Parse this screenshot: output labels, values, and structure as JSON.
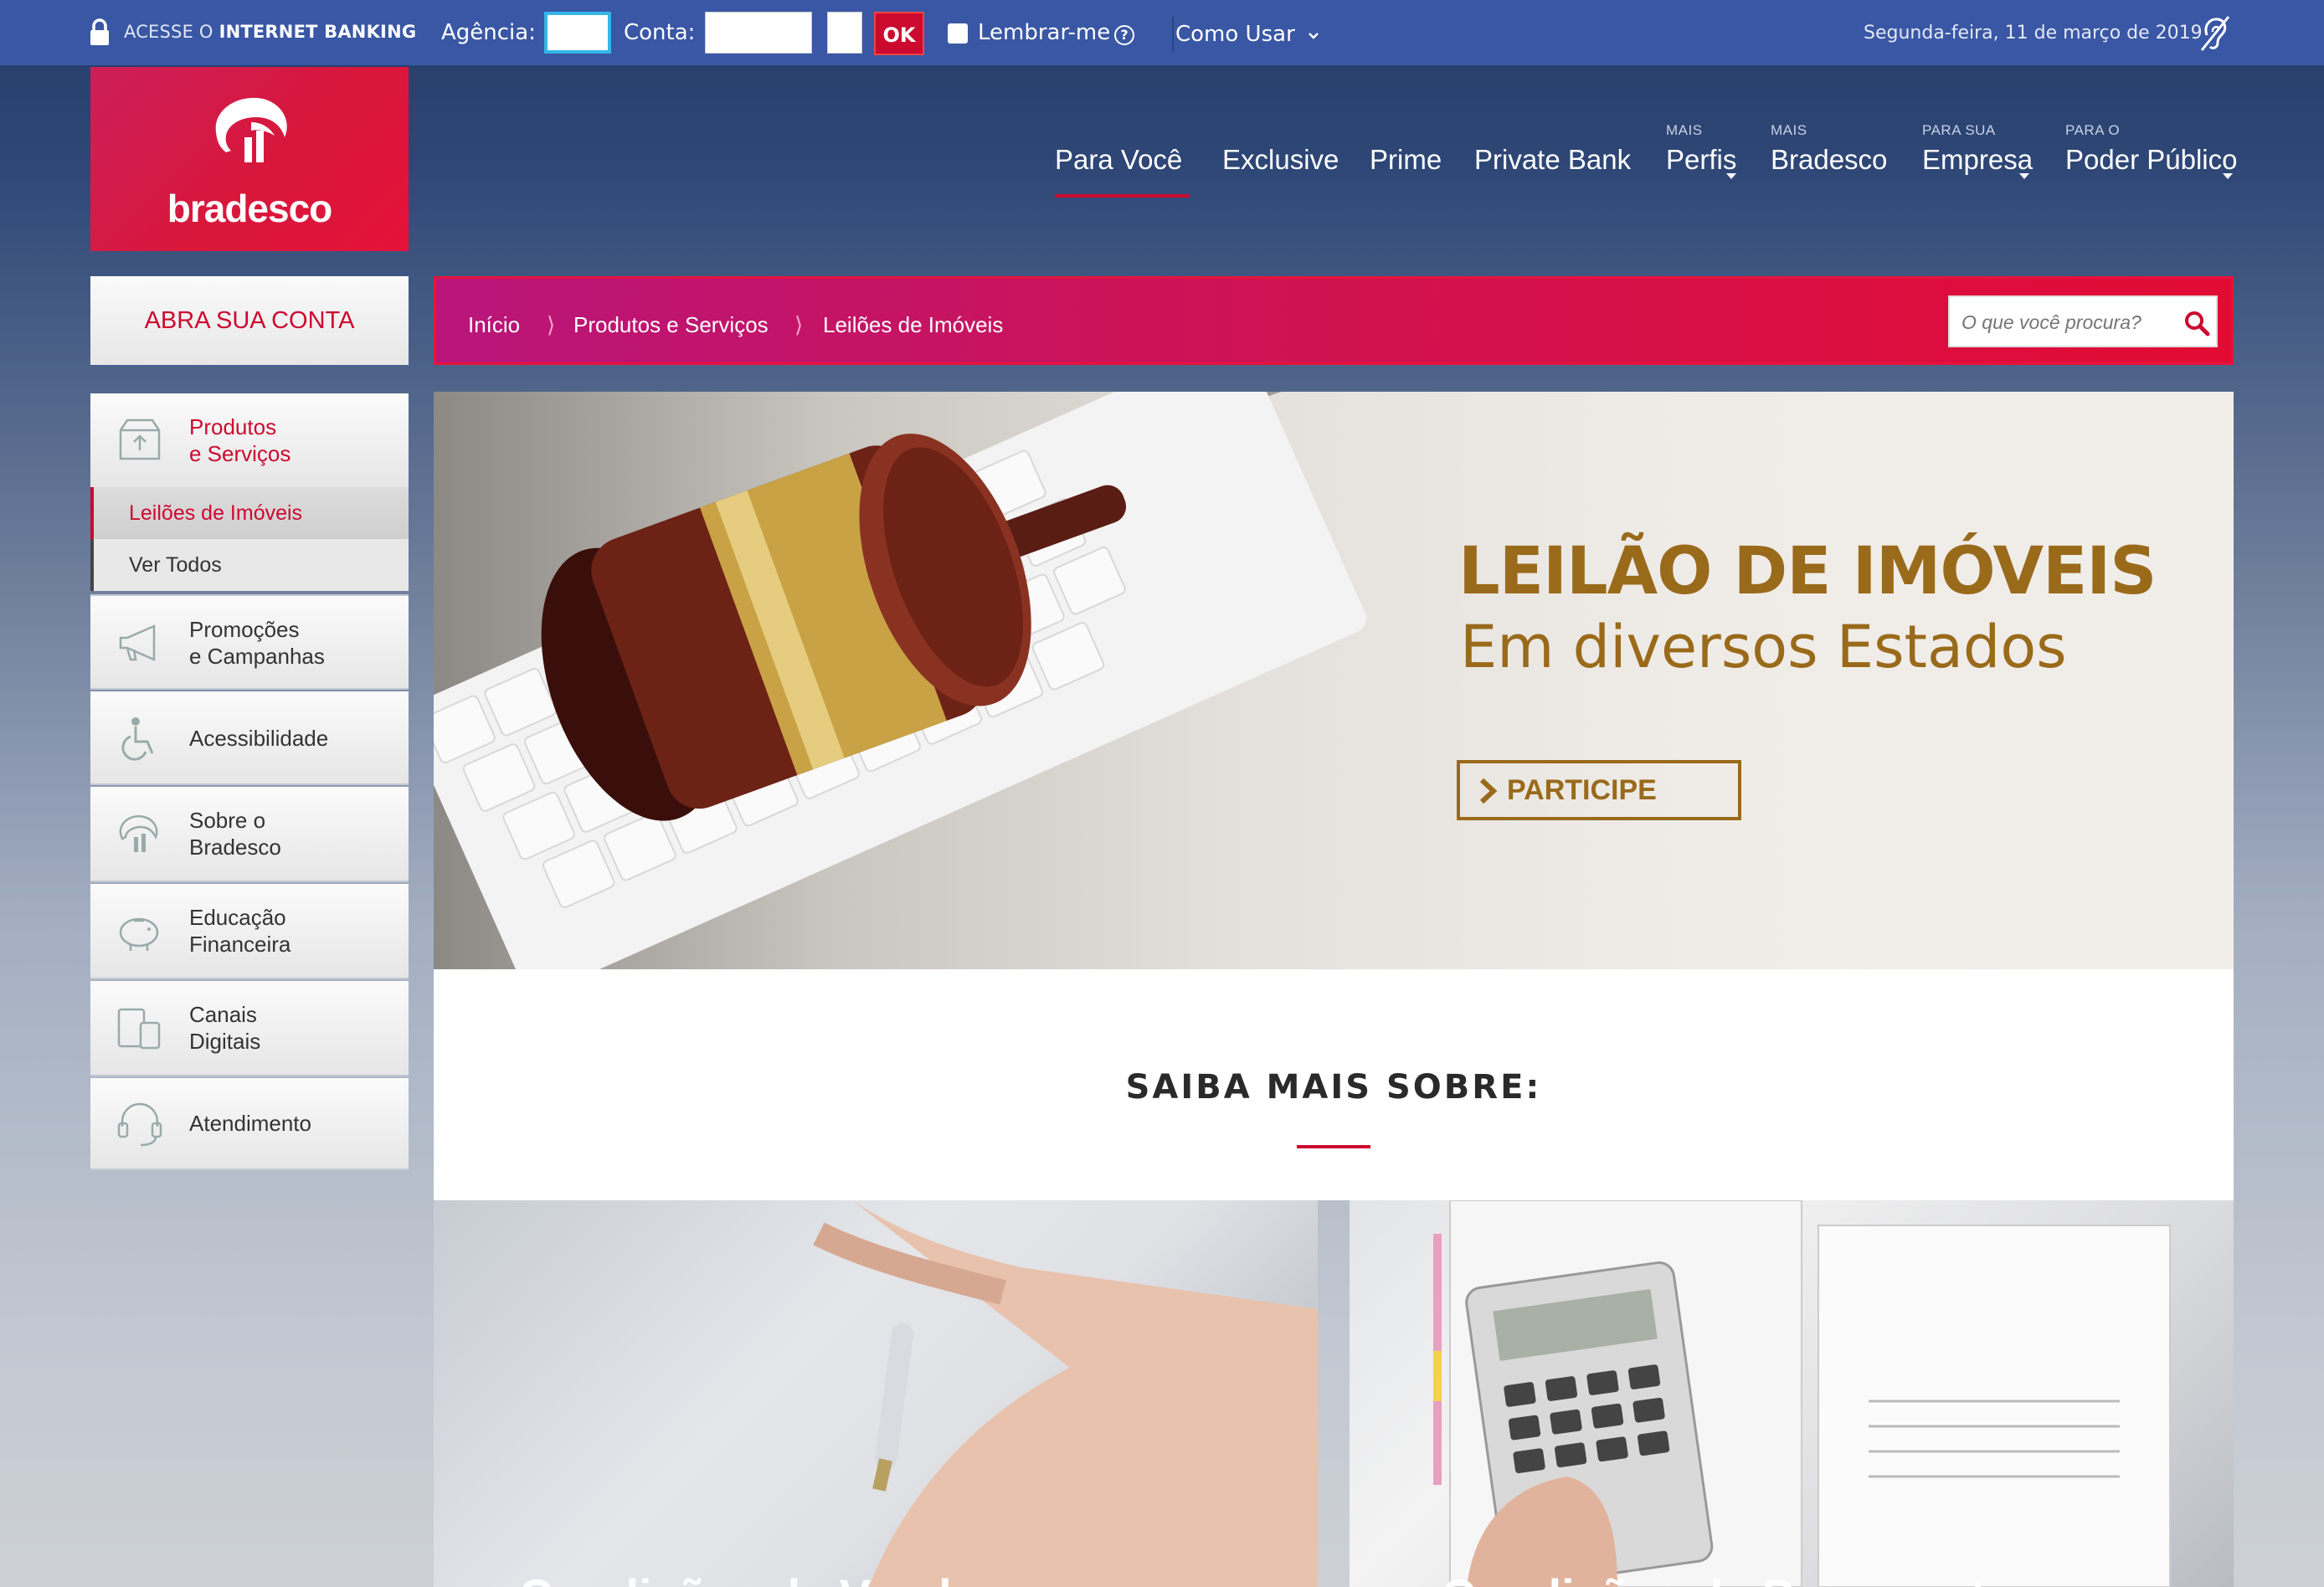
{
  "topbar": {
    "internet_banking_prefix": "ACESSE O",
    "internet_banking_bold": "INTERNET BANKING",
    "agencia_label": "Agência:",
    "conta_label": "Conta:",
    "ok_label": "OK",
    "remember_label": "Lembrar-me",
    "help_glyph": "?",
    "como_usar_label": "Como Usar",
    "date": "Segunda-feira, 11 de março de 2019",
    "icons": [
      "lock-icon",
      "help-icon",
      "chevron-down-icon",
      "hearing-icon"
    ]
  },
  "brand": {
    "name": "bradesco",
    "color": "#cc092f"
  },
  "nav": {
    "items": [
      {
        "small": "",
        "label": "Para Você",
        "active": true
      },
      {
        "small": "",
        "label": "Exclusive"
      },
      {
        "small": "",
        "label": "Prime"
      },
      {
        "small": "",
        "label": "Private Bank"
      },
      {
        "small": "MAIS",
        "label": "Perfis",
        "dropdown": true
      },
      {
        "small": "MAIS",
        "label": "Bradesco"
      },
      {
        "small": "PARA SUA",
        "label": "Empresa",
        "dropdown": true
      },
      {
        "small": "PARA O",
        "label": "Poder Público",
        "dropdown": true
      }
    ]
  },
  "sidebar": {
    "open_account_label": "ABRA SUA CONTA",
    "items": [
      {
        "label_line1": "Produtos",
        "label_line2": "e Serviços",
        "icon": "box-icon",
        "active": true
      },
      {
        "label_line1": "Promoções",
        "label_line2": "e Campanhas",
        "icon": "megaphone-icon"
      },
      {
        "label_line1": "Acessibilidade",
        "label_line2": "",
        "icon": "wheelchair-icon"
      },
      {
        "label_line1": "Sobre o",
        "label_line2": "Bradesco",
        "icon": "bradesco-logo-icon"
      },
      {
        "label_line1": "Educação",
        "label_line2": "Financeira",
        "icon": "piggy-bank-icon"
      },
      {
        "label_line1": "Canais",
        "label_line2": "Digitais",
        "icon": "devices-icon"
      },
      {
        "label_line1": "Atendimento",
        "label_line2": "",
        "icon": "headset-icon"
      }
    ],
    "sub_items": [
      {
        "label": "Leilões de Imóveis",
        "current": true
      },
      {
        "label": "Ver Todos"
      }
    ]
  },
  "breadcrumb": {
    "items": [
      "Início",
      "Produtos e Serviços",
      "Leilões de Imóveis"
    ],
    "separator": "⟩"
  },
  "search": {
    "placeholder": "O que você procura?"
  },
  "hero": {
    "title": "LEILÃO DE IMÓVEIS",
    "subtitle": "Em diversos Estados",
    "cta_label": "PARTICIPE",
    "accent_color": "#9a6a1b"
  },
  "main": {
    "section_title": "SAIBA MAIS SOBRE:",
    "cards": [
      {
        "title": "Condições de Venda"
      },
      {
        "title": "Condições de Pagamento"
      }
    ]
  }
}
